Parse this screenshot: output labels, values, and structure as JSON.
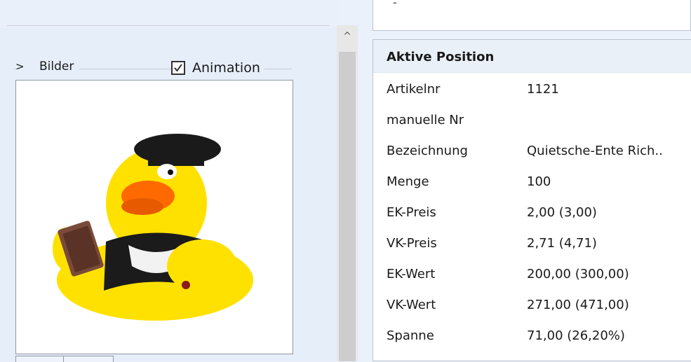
{
  "bilder_group": {
    "chevron": ">",
    "label": "Bilder",
    "animation_label": "Animation",
    "animation_checked": true
  },
  "scrollbar": {
    "up_arrow": "^"
  },
  "active_position": {
    "title": "Aktive Position",
    "rows": [
      {
        "label": "Artikelnr",
        "value": "1121"
      },
      {
        "label": "manuelle Nr",
        "value": ""
      },
      {
        "label": "Bezeichnung",
        "value": "Quietsche-Ente Rich.."
      },
      {
        "label": "Menge",
        "value": "100"
      },
      {
        "label": "EK-Preis",
        "value": "2,00 (3,00)"
      },
      {
        "label": "VK-Preis",
        "value": "2,71 (4,71)"
      },
      {
        "label": "EK-Wert",
        "value": "200,00 (300,00)"
      },
      {
        "label": "VK-Wert",
        "value": "271,00 (471,00)"
      },
      {
        "label": "Spanne",
        "value": "71,00 (26,20%)"
      }
    ]
  },
  "colors": {
    "highlight": "#f7ec1e",
    "duck_yellow": "#ffe100",
    "beak_orange": "#ff6a00"
  },
  "image": {
    "subject": "rubber-duck-professor-icon"
  }
}
